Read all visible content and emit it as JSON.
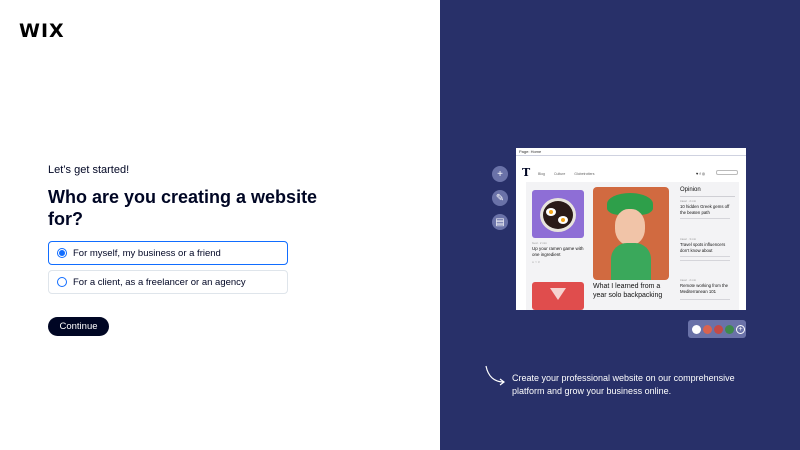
{
  "logo": "WIX",
  "form": {
    "kicker": "Let’s get started!",
    "title": "Who are you creating a website for?",
    "options": [
      {
        "label": "For myself, my business or a friend",
        "selected": true
      },
      {
        "label": "For a client, as a freelancer or an agency",
        "selected": false
      }
    ],
    "continue_label": "Continue"
  },
  "preview": {
    "bar_label": "Page: Home",
    "nav_links": "Blog Culture Globetrotters",
    "social": "♥ f ◎",
    "logo": "T",
    "card1": {
      "meta": "food · 2 min",
      "title": "Up your ramen game with one ingredient",
      "stats": "∞ ♡ 3"
    },
    "feature_title": "What I learned from a year solo backpacking",
    "opinion_header": "Opinion",
    "opinion_items": [
      {
        "meta": "travel · 2 min",
        "title": "10 hidden Greek gems off the beaten path"
      },
      {
        "meta": "travel · 3 min",
        "title": "Travel spots influencers don’t know about"
      },
      {
        "meta": "travel · 2 min",
        "title": "Remote working from the Mediterranean 101"
      }
    ]
  },
  "side_tools": [
    {
      "icon": "plus-icon",
      "glyph": "+"
    },
    {
      "icon": "brush-icon",
      "glyph": "✎"
    },
    {
      "icon": "page-icon",
      "glyph": "▤"
    }
  ],
  "palette": {
    "colors": [
      "#ffffff",
      "#d9634f",
      "#c34a47",
      "#3f8a4d"
    ],
    "add_glyph": "+"
  },
  "caption": "Create your professional website on our comprehensive platform and grow your business online.",
  "colors": {
    "panel": "#283069",
    "accent": "#116dff",
    "dark": "#000624"
  }
}
